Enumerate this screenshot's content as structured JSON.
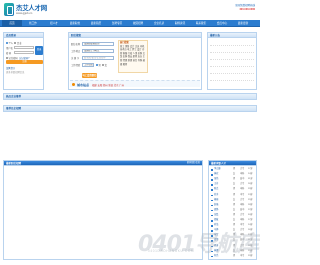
{
  "header": {
    "logo_text": "杰艾人才网",
    "logo_url": "www.gjjob.cn",
    "slogan": "全国免费招聘热线",
    "phone": "400-000-0000"
  },
  "nav": [
    "首页",
    "找工作",
    "招人才",
    "最新职位",
    "最新简历",
    "急聘专区",
    "校园招聘",
    "企业名录",
    "职场资讯",
    "联系我们",
    "会员中心",
    "最新更新"
  ],
  "login": {
    "title": "会员登录",
    "type_person": "个人",
    "type_company": "企业",
    "username_label": "用户名",
    "password_label": "密 码",
    "login_button": "登录",
    "register_button": "注册",
    "remember": "记住密码",
    "forgot": "忘记密码?",
    "tip_label": "温馨提示",
    "tip_text": "更多求职招聘信息"
  },
  "search": {
    "title": "职位搜索",
    "fields": [
      {
        "label": "职位名称",
        "value": "请选择职能类别"
      },
      {
        "label": "工作地点",
        "value": "请选择工作地点"
      },
      {
        "label": "关 键 字",
        "value": "如:姓名/职位/企业名称"
      },
      {
        "label": "工作经验",
        "value": "工作经验"
      }
    ],
    "gender_opts": [
      "男",
      "女"
    ],
    "button": "马上查找职位",
    "hot_title": "热门搜索",
    "hot_text": "普工 销售 会计 文员 司机 技术员 电工 焊工 设计 仓管 客服 行政 人事 采购 文案 出纳 保安 厨师 店长 主管 经理 助理 前台 导购 编辑 教师",
    "city_label": "城市站点",
    "city_list": "福建 安阳 郑州 新县 北京 广州"
  },
  "right_panel": {
    "title": "最新公告"
  },
  "strips": {
    "s1": "热点企业推荐",
    "s2": "推荐名企招聘",
    "s3": ""
  },
  "jobs": {
    "title": "最新职位招聘",
    "more": "更多职位信息"
  },
  "persons": {
    "title": "最新求职人才",
    "more": "更多",
    "rows": [
      {
        "name": "李立峰",
        "gender": "男",
        "edu": "大专",
        "age": "27岁"
      },
      {
        "name": "黄欢",
        "gender": "女",
        "edu": "本科",
        "age": "24岁"
      },
      {
        "name": "张伟",
        "gender": "男",
        "edu": "高中",
        "age": "31岁"
      },
      {
        "name": "王芳",
        "gender": "女",
        "edu": "大专",
        "age": "26岁"
      },
      {
        "name": "陈杰",
        "gender": "男",
        "edu": "本科",
        "age": "29岁"
      },
      {
        "name": "刘洋",
        "gender": "男",
        "edu": "中专",
        "age": "23岁"
      },
      {
        "name": "杨丽",
        "gender": "女",
        "edu": "大专",
        "age": "25岁"
      },
      {
        "name": "赵强",
        "gender": "男",
        "edu": "本科",
        "age": "28岁"
      },
      {
        "name": "周静",
        "gender": "女",
        "edu": "高中",
        "age": "22岁"
      },
      {
        "name": "吴磊",
        "gender": "男",
        "edu": "大专",
        "age": "30岁"
      },
      {
        "name": "郑敏",
        "gender": "女",
        "edu": "本科",
        "age": "27岁"
      },
      {
        "name": "孙浩",
        "gender": "男",
        "edu": "中专",
        "age": "24岁"
      },
      {
        "name": "马婷",
        "gender": "女",
        "edu": "大专",
        "age": "26岁"
      },
      {
        "name": "朱军",
        "gender": "男",
        "edu": "本科",
        "age": "33岁"
      },
      {
        "name": "胡雪",
        "gender": "女",
        "edu": "高中",
        "age": "21岁"
      },
      {
        "name": "郭涛",
        "gender": "男",
        "edu": "大专",
        "age": "28岁"
      },
      {
        "name": "林娜",
        "gender": "女",
        "edu": "本科",
        "age": "25岁"
      },
      {
        "name": "何亮",
        "gender": "男",
        "edu": "中专",
        "age": "29岁"
      }
    ]
  },
  "watermark": {
    "num": "0401导航库",
    "sub": "0401DAOHANGKU.COM"
  }
}
